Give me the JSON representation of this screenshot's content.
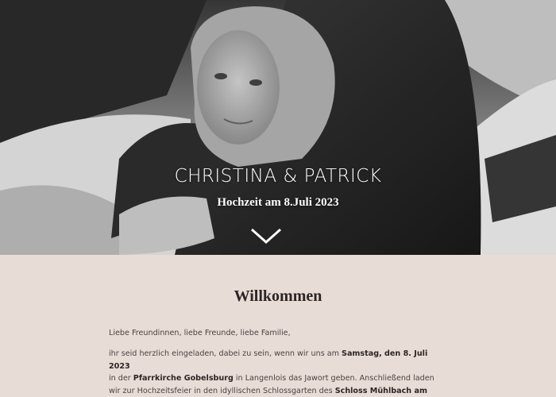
{
  "hero": {
    "title": "CHRISTINA & PATRICK",
    "subtitle": "Hochzeit am 8.Juli 2023",
    "scroll_icon": "chevron-down-icon"
  },
  "welcome": {
    "heading": "Willkommen",
    "greeting": "Liebe Freundinnen, liebe Freunde, liebe Familie,",
    "l1a": "ihr seid herzlich eingeladen, dabei zu sein, wenn wir uns am ",
    "l1b": "Samstag, den 8. Juli 2023",
    "l2a": "in der ",
    "l2b": "Pfarrkirche Gobelsburg",
    "l2c": " in Langenlois das Jawort geben. Anschließend laden",
    "l3a": "wir zur Hochzeitsfeier in den idyllischen Schlossgarten des ",
    "l3b": "Schloss Mühlbach am"
  },
  "colors": {
    "background": "#e8dcd6",
    "text": "#4a4242",
    "heading": "#2b2524"
  }
}
